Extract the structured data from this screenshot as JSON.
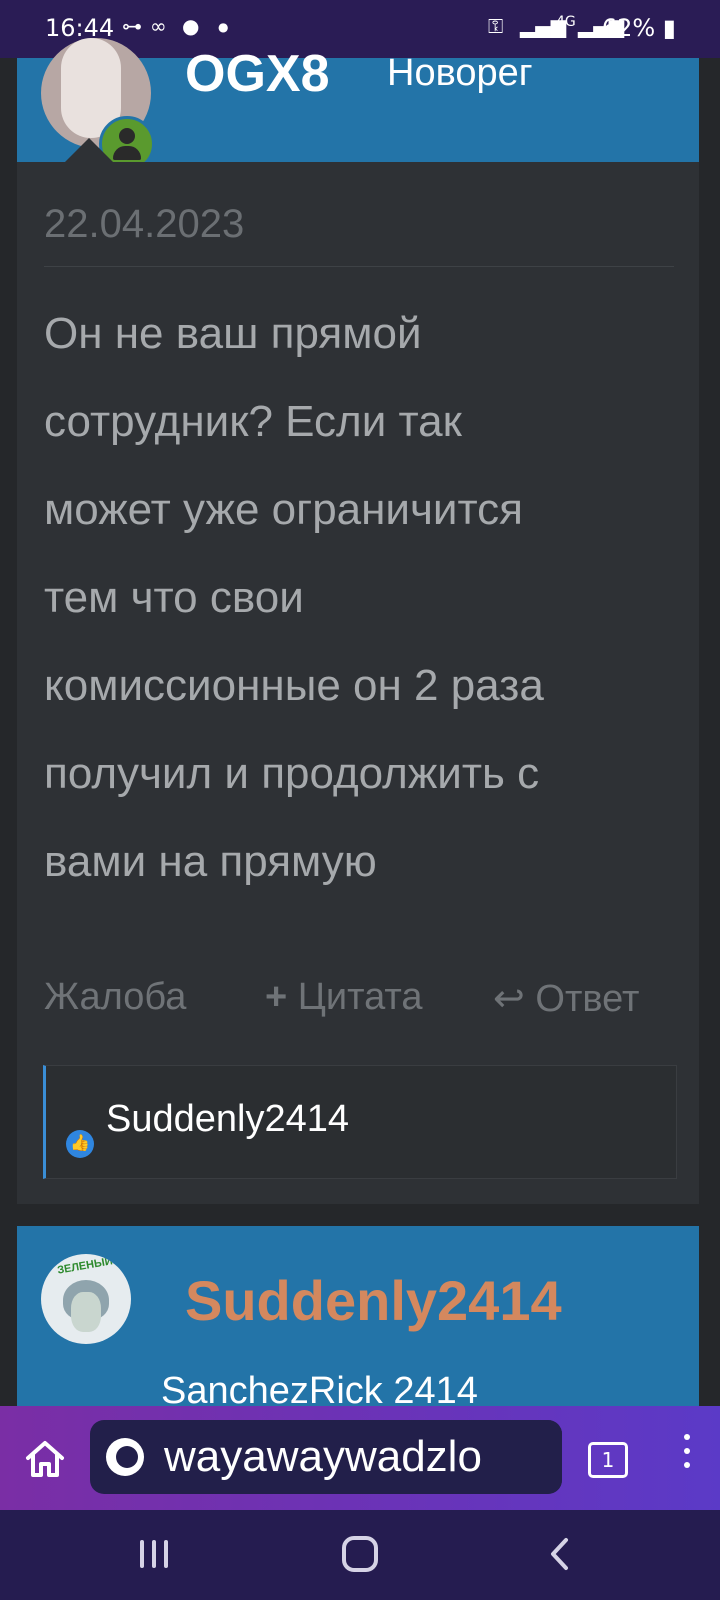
{
  "status_bar": {
    "time": "16:44",
    "battery": "62%"
  },
  "post1": {
    "username": "OGX8",
    "role": "Новорег",
    "date": "22.04.2023",
    "message_lines": [
      "Он не ваш прямой",
      "сотрудник? Если так",
      "может уже ограничится",
      "тем что свои",
      "комиссионные он 2 раза",
      "получил и продолжить с",
      "вами на прямую"
    ],
    "actions": {
      "report": "Жалоба",
      "quote": "Цитата",
      "reply": "Ответ"
    },
    "likes": {
      "user": "Suddenly2414"
    }
  },
  "post2": {
    "username": "Suddenly2414",
    "title": "SanchezRick 2414"
  },
  "browser": {
    "url": "wayawaywadzlo",
    "tab_count": "1"
  },
  "colors": {
    "header_blue": "#2374a8",
    "post_bg": "#2e3135",
    "username2_color": "#d4885e",
    "browser_purple": "#6a33b8"
  }
}
